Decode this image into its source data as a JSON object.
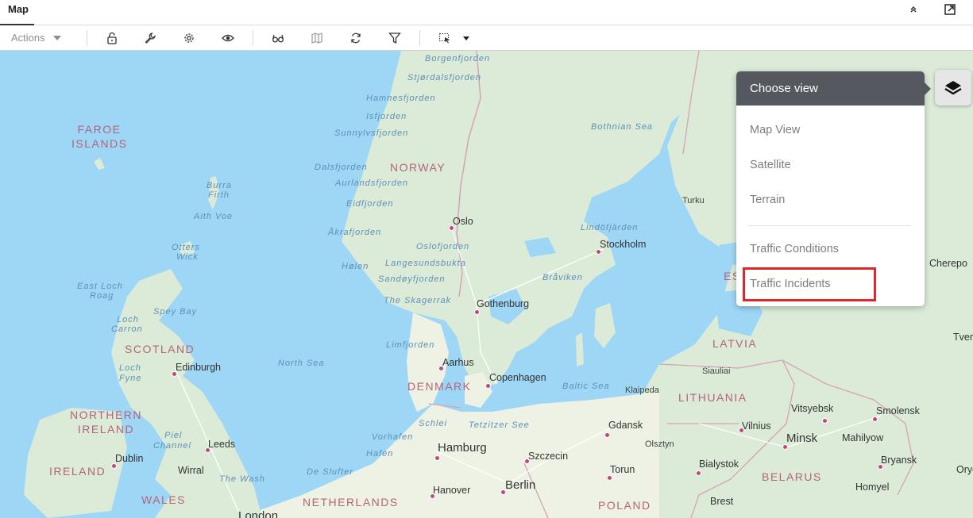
{
  "header": {
    "title": "Map"
  },
  "toolbar": {
    "actions_label": "Actions",
    "icons": [
      "unlock-icon",
      "wrench-icon",
      "gear-icon",
      "eye-icon",
      "glasses-icon",
      "map-icon",
      "refresh-icon",
      "filter-icon",
      "select-area-icon"
    ]
  },
  "menu": {
    "title": "Choose view",
    "views": [
      "Map View",
      "Satellite",
      "Terrain"
    ],
    "overlays": [
      "Traffic Conditions",
      "Traffic Incidents"
    ]
  },
  "labels": {
    "water": [
      "Borgenfjorden",
      "Stjørdalsfjorden",
      "Hamnesfjorden",
      "Isfjorden",
      "Sunnylvsfjorden",
      "Dalsfjorden",
      "Aurlandsfjorden",
      "Eidfjorden",
      "Åkrafjorden",
      "Oslofjorden",
      "Langesundsbukta",
      "Sandøyfjorden",
      "Hølen",
      "Burra",
      "Firth",
      "Aith Voe",
      "Otters",
      "Wick",
      "East Loch",
      "Roag",
      "Spey Bay",
      "Loch",
      "Carron",
      "Loch",
      "Fyne",
      "Bothnian Sea",
      "Lindöfjärden",
      "Bråviken",
      "The Skagerrak",
      "Limfjorden",
      "North Sea",
      "Baltic Sea",
      "Schlei",
      "Tetzitzer See",
      "Vorhafen",
      "Hafen",
      "De Slufter",
      "Piel",
      "Channel",
      "The Wash"
    ],
    "countries": [
      "FAROE ISLANDS",
      "NORWAY",
      "SCOTLAND",
      "NORTHERN IRELAND",
      "IRELAND",
      "WALES",
      "DENMARK",
      "NETHERLANDS",
      "LATVIA",
      "LITHUANIA",
      "BELARUS",
      "POLAND",
      "ES"
    ],
    "cities": [
      "Oslo",
      "Stockholm",
      "Gothenburg",
      "Aarhus",
      "Copenhagen",
      "Edinburgh",
      "Leeds",
      "Dublin",
      "Wirral",
      "Hamburg",
      "Berlin",
      "Hanover",
      "Szczecin",
      "Gdansk",
      "Torun",
      "Bialystok",
      "Vilnius",
      "Minsk",
      "Vitsyebsk",
      "Smolensk",
      "Mahilyow",
      "Bryansk",
      "Homyel",
      "Brest",
      "London",
      "Turku",
      "Klaipeda",
      "Siauliai",
      "Olsztyn",
      "Cherepo",
      "Tver",
      "Oryo"
    ]
  }
}
